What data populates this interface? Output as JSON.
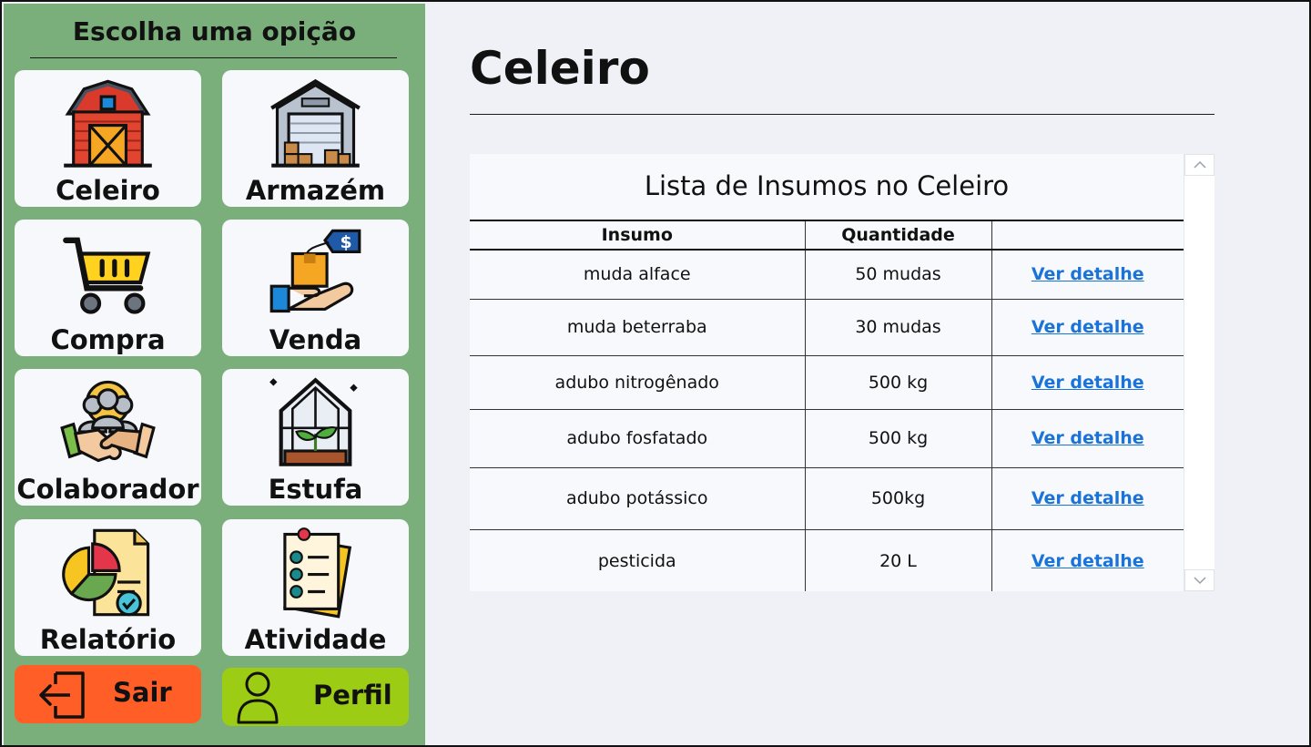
{
  "sidebar": {
    "title": "Escolha uma opição",
    "tiles": [
      {
        "label": "Celeiro",
        "icon": "barn-icon"
      },
      {
        "label": "Armazém",
        "icon": "warehouse-icon"
      },
      {
        "label": "Compra",
        "icon": "shopping-cart-icon"
      },
      {
        "label": "Venda",
        "icon": "sale-hand-icon"
      },
      {
        "label": "Colaborador",
        "icon": "team-handshake-icon"
      },
      {
        "label": "Estufa",
        "icon": "greenhouse-icon"
      },
      {
        "label": "Relatório",
        "icon": "report-chart-icon"
      },
      {
        "label": "Atividade",
        "icon": "checklist-icon"
      }
    ],
    "logout": {
      "label": "Sair",
      "icon": "logout-icon",
      "color": "#ff5e26"
    },
    "profile": {
      "label": "Perfil",
      "icon": "user-icon",
      "color": "#9ccc13"
    }
  },
  "main": {
    "title": "Celeiro",
    "panel_title": "Lista de Insumos no Celeiro",
    "table": {
      "headers": [
        "Insumo",
        "Quantidade",
        ""
      ],
      "rows": [
        {
          "insumo": "muda alface",
          "quantidade": "50 mudas",
          "link": "Ver detalhe"
        },
        {
          "insumo": "muda beterraba",
          "quantidade": "30 mudas",
          "link": "Ver detalhe"
        },
        {
          "insumo": "adubo nitrogênado",
          "quantidade": "500 kg",
          "link": "Ver detalhe"
        },
        {
          "insumo": "adubo fosfatado",
          "quantidade": "500 kg",
          "link": "Ver detalhe"
        },
        {
          "insumo": "adubo potássico",
          "quantidade": "500kg",
          "link": "Ver detalhe"
        },
        {
          "insumo": "pesticida",
          "quantidade": "20 L",
          "link": "Ver detalhe"
        }
      ]
    }
  },
  "colors": {
    "sidebar": "#7aaf7c",
    "background": "#f0f1f6",
    "link": "#1a73d9"
  }
}
